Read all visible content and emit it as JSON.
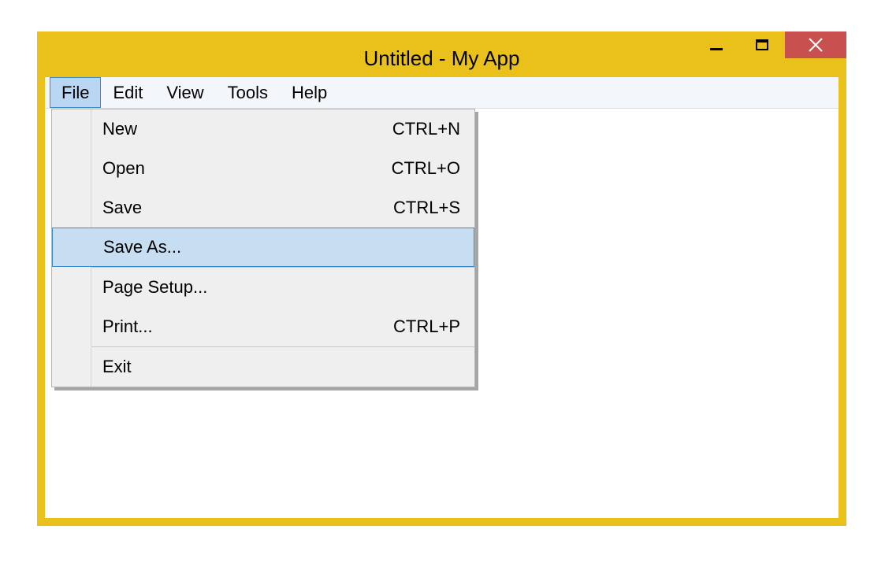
{
  "window": {
    "title": "Untitled - My App"
  },
  "menubar": {
    "items": [
      {
        "label": "File",
        "active": true
      },
      {
        "label": "Edit",
        "active": false
      },
      {
        "label": "View",
        "active": false
      },
      {
        "label": "Tools",
        "active": false
      },
      {
        "label": "Help",
        "active": false
      }
    ]
  },
  "file_menu": {
    "items": [
      {
        "label": "New",
        "shortcut": "CTRL+N",
        "hover": false
      },
      {
        "label": "Open",
        "shortcut": "CTRL+O",
        "hover": false
      },
      {
        "label": "Save",
        "shortcut": "CTRL+S",
        "hover": false
      },
      {
        "label": "Save As...",
        "shortcut": "",
        "hover": true
      }
    ],
    "items2": [
      {
        "label": "Page Setup...",
        "shortcut": ""
      },
      {
        "label": "Print...",
        "shortcut": "CTRL+P"
      }
    ],
    "items3": [
      {
        "label": "Exit",
        "shortcut": ""
      }
    ]
  }
}
